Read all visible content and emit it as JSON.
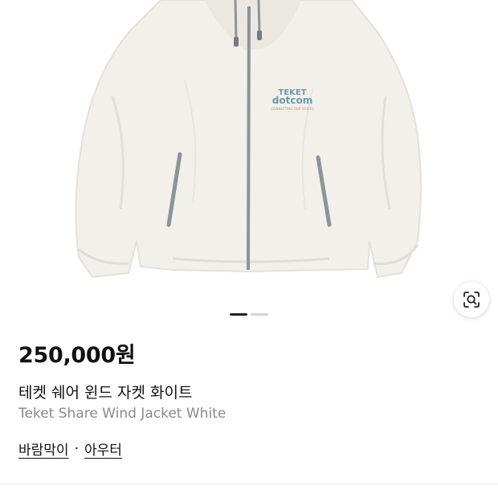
{
  "product": {
    "price": "250,000원",
    "title_ko": "테켓 쉐어 윈드 자켓 화이트",
    "title_en": "Teket Share Wind Jacket White",
    "categories": [
      "바람막이",
      "아우터"
    ],
    "category_separator": "·"
  },
  "image": {
    "logo_line1": "TEKET",
    "logo_line2": "dotcom",
    "logo_line3": "CONNECTING OUR VOICES"
  },
  "carousel": {
    "current_slide": 1,
    "total_slides": 2
  },
  "icons": {
    "image_search": "lens-scan-icon"
  },
  "colors": {
    "jacket": "#f1efea",
    "zipper": "#8e9396",
    "logo": "#6b9aa5",
    "active_dot": "#222222",
    "inactive_dot": "#d4d4d4"
  }
}
